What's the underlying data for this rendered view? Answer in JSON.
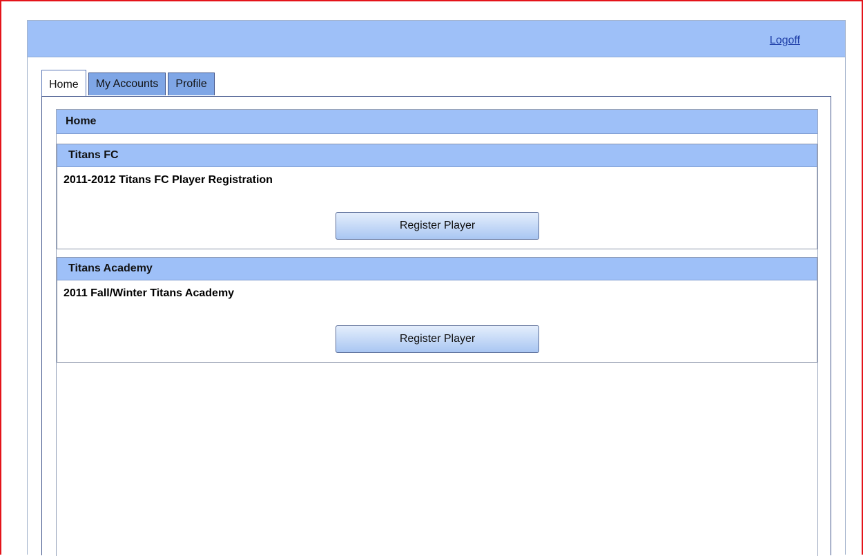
{
  "header": {
    "logoff_label": "Logoff"
  },
  "tabs": [
    {
      "label": "Home",
      "active": true
    },
    {
      "label": "My Accounts",
      "active": false
    },
    {
      "label": "Profile",
      "active": false
    }
  ],
  "home_panel": {
    "title": "Home",
    "sections": [
      {
        "header": "Titans FC",
        "item_title": "2011-2012 Titans FC Player Registration",
        "button_label": "Register Player"
      },
      {
        "header": "Titans Academy",
        "item_title": "2011 Fall/Winter Titans Academy",
        "button_label": "Register Player"
      }
    ]
  },
  "colors": {
    "header_blue": "#9ec0f8",
    "tab_inactive": "#7fa6e6",
    "frame_red": "#e4141b",
    "link_blue": "#1f3fa8"
  }
}
